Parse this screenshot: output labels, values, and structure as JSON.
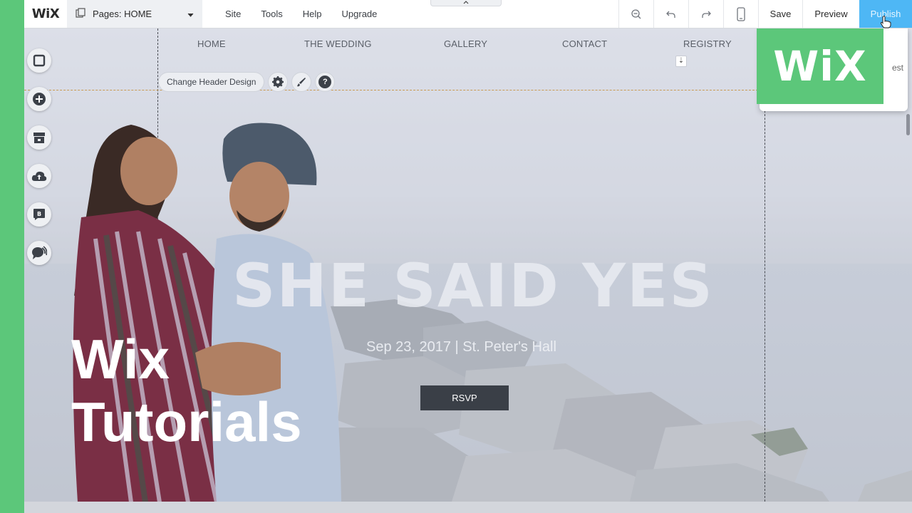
{
  "toolbar": {
    "logo": "WiX",
    "pages_label": "Pages: HOME",
    "menu": [
      "Site",
      "Tools",
      "Help",
      "Upgrade"
    ],
    "save": "Save",
    "preview": "Preview",
    "publish": "Publish",
    "icons": [
      "zoom-out-icon",
      "undo-icon",
      "redo-icon",
      "mobile-view-icon"
    ]
  },
  "site_nav": {
    "items": [
      "HOME",
      "THE WEDDING",
      "GALLERY",
      "CONTACT",
      "REGISTRY"
    ]
  },
  "header_tools": {
    "change_header": "Change Header Design",
    "icons": [
      "settings-icon",
      "design-brush-icon",
      "help-icon"
    ]
  },
  "left_bar": {
    "icons": [
      "background-icon",
      "add-icon",
      "app-market-icon",
      "upload-icon",
      "blog-icon",
      "chat-icon"
    ]
  },
  "hero": {
    "title": "SHE SAID YES",
    "subtitle": "Sep 23, 2017 | St. Peter's Hall",
    "button": "RSVP"
  },
  "overlay": {
    "line1": "Wix",
    "line2": "Tutorials",
    "logo": "WiX"
  },
  "publish_dropdown": {
    "partial_text": "est"
  },
  "colors": {
    "brand_green": "#5cc77a",
    "publish_blue": "#4eb7f5",
    "rsvp_dark": "#3a3f47"
  }
}
